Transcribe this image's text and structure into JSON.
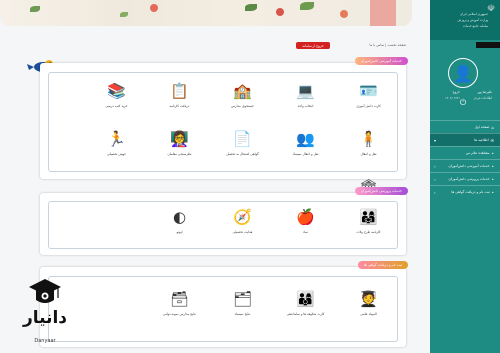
{
  "topbar": {
    "logout_label": "خروج از سامانه",
    "breadcrumb": "صفحه نخست  |  تماس با ما"
  },
  "sections": [
    {
      "title": "خدمات آموزشی دانش‌آموزان",
      "items": [
        {
          "label": "کارت دانش آموزی",
          "icon": "id-card-icon",
          "glyph": "🪪"
        },
        {
          "label": "انتخاب واحد",
          "icon": "laptop-selection-icon",
          "glyph": "💻"
        },
        {
          "label": "جستجوی مدارس",
          "icon": "school-search-icon",
          "glyph": "🏫"
        },
        {
          "label": "دریافت کارنامه",
          "icon": "report-card-icon",
          "glyph": "📋"
        },
        {
          "label": "خرید کتب درسی",
          "icon": "textbooks-icon",
          "glyph": "📚"
        },
        {
          "label": "نقل و انتقال",
          "icon": "transfer-icon",
          "glyph": "🧍"
        },
        {
          "label": "نقل و انتقال نمیساد",
          "icon": "transfer-students-icon",
          "glyph": "👥"
        },
        {
          "label": "گواهی اشتغال به تحصیل",
          "icon": "certificate-icon",
          "glyph": "📄"
        },
        {
          "label": "نظرسنجی معلمان",
          "icon": "teacher-survey-icon",
          "glyph": "👩‍🏫"
        },
        {
          "label": "جهش تحصیلی",
          "icon": "academic-jump-icon",
          "glyph": "🏃"
        },
        {
          "label": "مدارس مستعدان تیزهوشان",
          "icon": "gifted-schools-icon",
          "glyph": "🏛"
        }
      ]
    },
    {
      "title": "خدمات پرورشی دانش‌آموزان",
      "items": [
        {
          "label": "کارنامه طرح ولات",
          "icon": "plan-report-icon",
          "glyph": "👨‍👩‍👧"
        },
        {
          "label": "نماد",
          "icon": "symbol-icon",
          "glyph": "🍎"
        },
        {
          "label": "هدایت تحصیلی",
          "icon": "guidance-icon",
          "glyph": "🧭"
        },
        {
          "label": "اپوتو",
          "icon": "app-logo-icon",
          "glyph": "◐"
        }
      ]
    },
    {
      "title": "ثبت نام و دریافت گواهی ها",
      "items": [
        {
          "label": "المپیاد علمی",
          "icon": "olympiad-icon",
          "glyph": "🧑‍🎓"
        },
        {
          "label": "کارت شکوفه ها و ساماندهی",
          "icon": "blossom-card-icon",
          "glyph": "👨‍👩‍👦"
        },
        {
          "label": "نتایج نمیساد",
          "icon": "results-icon",
          "glyph": "🗂"
        },
        {
          "label": "نتایج مدارس نمونه دولتی",
          "icon": "model-school-results-icon",
          "glyph": "🗃"
        }
      ]
    }
  ],
  "sidebar": {
    "header_line1": "جمهوری اسلامی ایران",
    "header_line2": "وزارت آموزش و پرورش",
    "header_line3": "سامانه جامع خدمات",
    "meta_name": "علیرضا پور",
    "meta_sub": "اطلاعات فردی",
    "meta_logout": "خروج",
    "meta_date": "۱۴۰۲/۰۴/۲۱",
    "menu": [
      {
        "label": "صفحه اول",
        "icon": "home-icon",
        "glyph": "⌂",
        "head": false
      },
      {
        "label": "اطلاعیه ها",
        "icon": "announcements-icon",
        "glyph": "✉",
        "head": true,
        "caret": "▾"
      },
      {
        "label": "مشاهده علام س",
        "icon": "view-icon",
        "glyph": "•",
        "head": false
      },
      {
        "label": "خدمات آموزشی دانش‌آموزان",
        "icon": "education-icon",
        "glyph": "•",
        "head": false,
        "caret": "‹"
      },
      {
        "label": "خدمات پرورشی دانش‌آموزان",
        "icon": "cultural-icon",
        "glyph": "•",
        "head": false,
        "caret": "‹"
      },
      {
        "label": "ثبت نام و دریافت گواهی ها",
        "icon": "register-icon",
        "glyph": "•",
        "head": false,
        "caret": "‹"
      }
    ]
  },
  "watermark": {
    "word": "دانیار",
    "latin": "Danyaar"
  },
  "colors": {
    "sidebar": "#1f8c84",
    "sidebar_header": "#0c6f68",
    "logout": "#d32222"
  }
}
